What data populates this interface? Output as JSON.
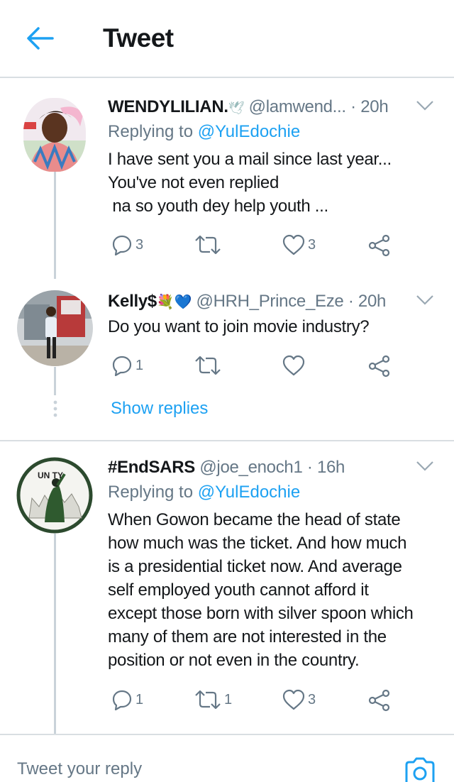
{
  "header": {
    "title": "Tweet"
  },
  "tweets": [
    {
      "name": "WENDYLILIAN.",
      "name_emoji": "🕊",
      "handle": "@lamwend...",
      "time": "· 20h",
      "replying_prefix": "Replying to",
      "replying_handle": "@YulEdochie",
      "text": "I have sent you a mail since last year...\nYou've not even replied\n na so youth dey help youth ...",
      "reply_count": "3",
      "retweet_count": "",
      "like_count": "3"
    },
    {
      "name": "Kelly$",
      "name_emoji": "💐💙",
      "handle": "@HRH_Prince_Eze",
      "time": "· 20h",
      "text": "Do you want to join movie industry?",
      "reply_count": "1",
      "retweet_count": "",
      "like_count": "",
      "show_replies": "Show replies"
    },
    {
      "name": "#EndSARS",
      "handle": "@joe_enoch1",
      "time": "· 16h",
      "replying_prefix": "Replying to",
      "replying_handle": "@YulEdochie",
      "avatar_text": "UN TY",
      "text": "When Gowon became the head of state\nhow much was the ticket. And how much\nis a presidential ticket now. And average\nself employed youth cannot afford it\nexcept those born with silver spoon which\nmany of them are not interested in the\nposition or not even in the country.",
      "reply_count": "1",
      "retweet_count": "1",
      "like_count": "3"
    }
  ],
  "reply_bar": {
    "placeholder": "Tweet your reply"
  },
  "colors": {
    "accent": "#1da1f2",
    "muted": "#657786",
    "divider": "#d9dee2"
  },
  "icons": [
    "back-arrow-icon",
    "chevron-down-icon",
    "reply-icon",
    "retweet-icon",
    "like-icon",
    "share-icon",
    "camera-icon"
  ]
}
